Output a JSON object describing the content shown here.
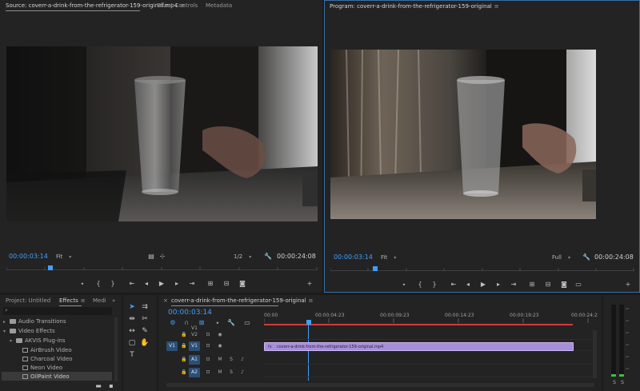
{
  "source_panel": {
    "tab_source": "Source: coverr-a-drink-from-the-refrigerator-159-original.mp4",
    "tab_effect_controls": "Effect Controls",
    "tab_metadata": "Metadata",
    "timecode_current": "00:00:03:14",
    "zoom": "Fit",
    "resolution": "1/2",
    "timecode_duration": "00:00:24:08"
  },
  "program_panel": {
    "tab_program": "Program: coverr-a-drink-from-the-refrigerator-159-original",
    "timecode_current": "00:00:03:14",
    "zoom": "Fit",
    "resolution": "Full",
    "timecode_duration": "00:00:24:08"
  },
  "project_panel": {
    "tab_project": "Project: Untitled",
    "tab_effects": "Effects",
    "tab_media": "Medi",
    "overflow": "»",
    "tree": [
      {
        "label": "Audio Transitions",
        "type": "folder",
        "level": 0,
        "expanded": false
      },
      {
        "label": "Video Effects",
        "type": "folder",
        "level": 0,
        "expanded": true
      },
      {
        "label": "AKVIS Plug-ins",
        "type": "folder",
        "level": 1,
        "expanded": true
      },
      {
        "label": "AirBrush Video",
        "type": "effect",
        "level": 2
      },
      {
        "label": "Charcoal Video",
        "type": "effect",
        "level": 2
      },
      {
        "label": "Neon Video",
        "type": "effect",
        "level": 2
      },
      {
        "label": "OilPaint Video",
        "type": "effect",
        "level": 2,
        "selected": true
      }
    ]
  },
  "timeline_panel": {
    "tab_sequence": "coverr-a-drink-from-the-refrigerator-159-original",
    "timecode_current": "00:00:03:14",
    "ruler_labels": [
      "00:00",
      "00:00:04:23",
      "00:00:09:23",
      "00:00:14:23",
      "00:00:19:23",
      "00:00:24:2"
    ],
    "tracks": {
      "v2": "V2",
      "v1_label": "V1",
      "v1_target": "V1",
      "v1_header": "V1",
      "a1_label": "A1",
      "a1_target": "A1",
      "a2_label": "A2",
      "m": "M",
      "s": "S"
    },
    "clip_name": "coverr-a-drink-from-the-refrigerator-159-original.mp4",
    "clip_fx": "fx",
    "clip_color": "#a78ed8"
  },
  "audio_meter": {
    "solo_left": "S",
    "solo_right": "S"
  },
  "colors": {
    "accent": "#3f9fff",
    "panel_bg": "#232323",
    "app_bg": "#1b1b1b",
    "program_border": "#3a6fa8"
  }
}
